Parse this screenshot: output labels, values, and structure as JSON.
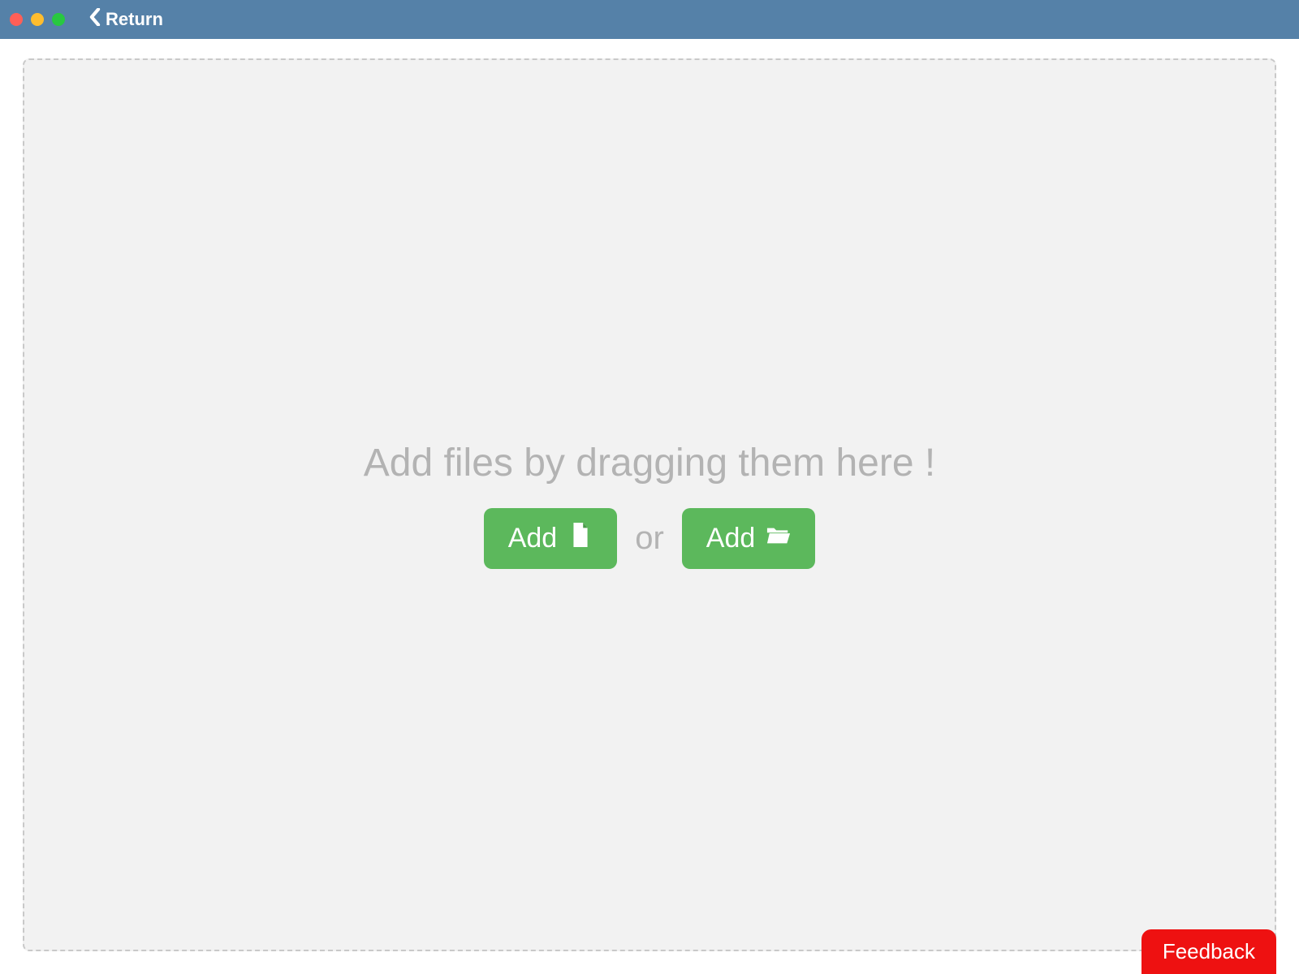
{
  "titlebar": {
    "return_label": "Return"
  },
  "dropzone": {
    "hint": "Add files by dragging them here !",
    "add_file_label": "Add",
    "or_label": "or",
    "add_folder_label": "Add"
  },
  "feedback": {
    "label": "Feedback"
  },
  "colors": {
    "titlebar_bg": "#5581A8",
    "button_green": "#5CB85C",
    "feedback_red": "#EE1111",
    "hint_gray": "#b3b3b3",
    "dropzone_bg": "#f2f2f2",
    "dropzone_border": "#c9c9c9"
  },
  "icons": {
    "return": "chevron-left-icon",
    "add_file": "file-icon",
    "add_folder": "folder-open-icon"
  }
}
